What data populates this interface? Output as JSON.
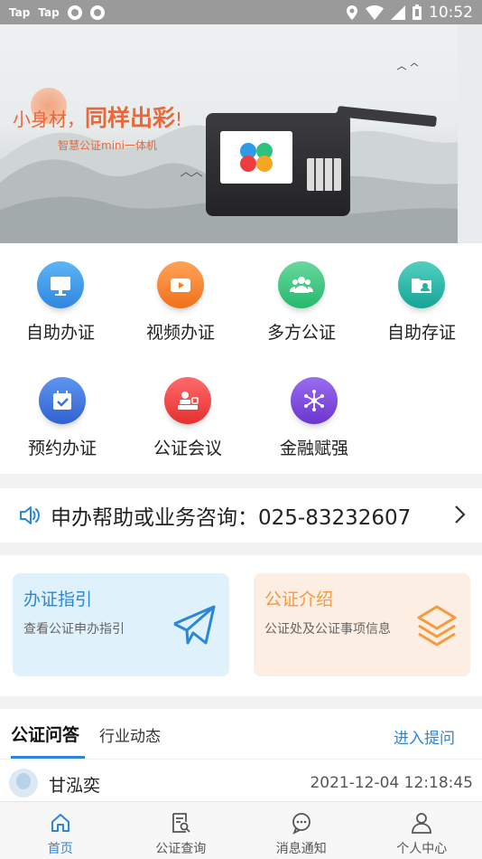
{
  "status_bar": {
    "apps": [
      "Tap",
      "Tap"
    ],
    "time": "10:52"
  },
  "banner": {
    "headline_prefix": "小身材，",
    "headline_emphasis": "同样出彩",
    "headline_suffix": "!",
    "subtitle": "智慧公证mini一体机",
    "page_count": 2,
    "active_page": 1
  },
  "services": [
    {
      "label": "自助办证",
      "icon": "monitor-icon",
      "color": "#2f9ae8"
    },
    {
      "label": "视频办证",
      "icon": "video-icon",
      "color": "#f57e22"
    },
    {
      "label": "多方公证",
      "icon": "group-icon",
      "color": "#2ec27e"
    },
    {
      "label": "自助存证",
      "icon": "folder-user-icon",
      "color": "#1fb3a4"
    },
    {
      "label": "预约办证",
      "icon": "calendar-check-icon",
      "color": "#3a73dd"
    },
    {
      "label": "公证会议",
      "icon": "stamp-icon",
      "color": "#ef3d3d"
    },
    {
      "label": "金融赋强",
      "icon": "network-icon",
      "color": "#7b47d9"
    }
  ],
  "hotline": {
    "text": "申办帮助或业务咨询：025-83232607",
    "icon": "speaker-icon"
  },
  "cards": {
    "guide": {
      "title": "办证指引",
      "desc": "查看公证申办指引",
      "icon": "paper-plane-icon",
      "color": "#2a86d9",
      "bg": "#dff1fb"
    },
    "intro": {
      "title": "公证介绍",
      "desc": "公证处及公证事项信息",
      "icon": "layers-icon",
      "color": "#f59a3d",
      "bg": "#fdeee3"
    }
  },
  "qa": {
    "active_tab": "公证问答",
    "second_tab": "行业动态",
    "ask_link": "进入提问",
    "entries": [
      {
        "user": "甘泓奕",
        "time": "2021-12-04 12:18:45"
      }
    ]
  },
  "tabbar": [
    {
      "label": "首页",
      "icon": "home-icon",
      "active": true
    },
    {
      "label": "公证查询",
      "icon": "document-search-icon",
      "active": false
    },
    {
      "label": "消息通知",
      "icon": "chat-bubble-icon",
      "active": false
    },
    {
      "label": "个人中心",
      "icon": "person-icon",
      "active": false
    }
  ]
}
